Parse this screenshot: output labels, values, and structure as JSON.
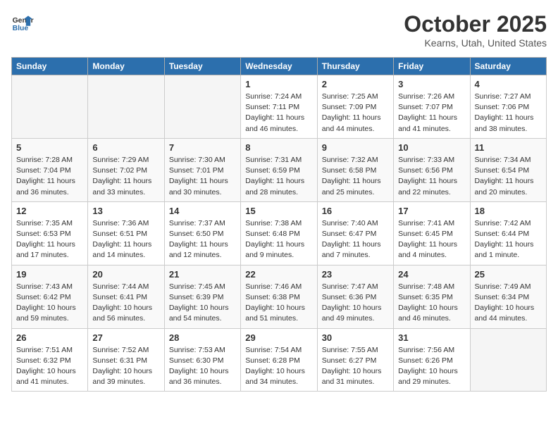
{
  "header": {
    "logo_line1": "General",
    "logo_line2": "Blue",
    "month": "October 2025",
    "location": "Kearns, Utah, United States"
  },
  "days_of_week": [
    "Sunday",
    "Monday",
    "Tuesday",
    "Wednesday",
    "Thursday",
    "Friday",
    "Saturday"
  ],
  "weeks": [
    [
      {
        "day": "",
        "empty": true
      },
      {
        "day": "",
        "empty": true
      },
      {
        "day": "",
        "empty": true
      },
      {
        "day": "1",
        "rise": "7:24 AM",
        "set": "7:11 PM",
        "daylight": "11 hours and 46 minutes."
      },
      {
        "day": "2",
        "rise": "7:25 AM",
        "set": "7:09 PM",
        "daylight": "11 hours and 44 minutes."
      },
      {
        "day": "3",
        "rise": "7:26 AM",
        "set": "7:07 PM",
        "daylight": "11 hours and 41 minutes."
      },
      {
        "day": "4",
        "rise": "7:27 AM",
        "set": "7:06 PM",
        "daylight": "11 hours and 38 minutes."
      }
    ],
    [
      {
        "day": "5",
        "rise": "7:28 AM",
        "set": "7:04 PM",
        "daylight": "11 hours and 36 minutes."
      },
      {
        "day": "6",
        "rise": "7:29 AM",
        "set": "7:02 PM",
        "daylight": "11 hours and 33 minutes."
      },
      {
        "day": "7",
        "rise": "7:30 AM",
        "set": "7:01 PM",
        "daylight": "11 hours and 30 minutes."
      },
      {
        "day": "8",
        "rise": "7:31 AM",
        "set": "6:59 PM",
        "daylight": "11 hours and 28 minutes."
      },
      {
        "day": "9",
        "rise": "7:32 AM",
        "set": "6:58 PM",
        "daylight": "11 hours and 25 minutes."
      },
      {
        "day": "10",
        "rise": "7:33 AM",
        "set": "6:56 PM",
        "daylight": "11 hours and 22 minutes."
      },
      {
        "day": "11",
        "rise": "7:34 AM",
        "set": "6:54 PM",
        "daylight": "11 hours and 20 minutes."
      }
    ],
    [
      {
        "day": "12",
        "rise": "7:35 AM",
        "set": "6:53 PM",
        "daylight": "11 hours and 17 minutes."
      },
      {
        "day": "13",
        "rise": "7:36 AM",
        "set": "6:51 PM",
        "daylight": "11 hours and 14 minutes."
      },
      {
        "day": "14",
        "rise": "7:37 AM",
        "set": "6:50 PM",
        "daylight": "11 hours and 12 minutes."
      },
      {
        "day": "15",
        "rise": "7:38 AM",
        "set": "6:48 PM",
        "daylight": "11 hours and 9 minutes."
      },
      {
        "day": "16",
        "rise": "7:40 AM",
        "set": "6:47 PM",
        "daylight": "11 hours and 7 minutes."
      },
      {
        "day": "17",
        "rise": "7:41 AM",
        "set": "6:45 PM",
        "daylight": "11 hours and 4 minutes."
      },
      {
        "day": "18",
        "rise": "7:42 AM",
        "set": "6:44 PM",
        "daylight": "11 hours and 1 minute."
      }
    ],
    [
      {
        "day": "19",
        "rise": "7:43 AM",
        "set": "6:42 PM",
        "daylight": "10 hours and 59 minutes."
      },
      {
        "day": "20",
        "rise": "7:44 AM",
        "set": "6:41 PM",
        "daylight": "10 hours and 56 minutes."
      },
      {
        "day": "21",
        "rise": "7:45 AM",
        "set": "6:39 PM",
        "daylight": "10 hours and 54 minutes."
      },
      {
        "day": "22",
        "rise": "7:46 AM",
        "set": "6:38 PM",
        "daylight": "10 hours and 51 minutes."
      },
      {
        "day": "23",
        "rise": "7:47 AM",
        "set": "6:36 PM",
        "daylight": "10 hours and 49 minutes."
      },
      {
        "day": "24",
        "rise": "7:48 AM",
        "set": "6:35 PM",
        "daylight": "10 hours and 46 minutes."
      },
      {
        "day": "25",
        "rise": "7:49 AM",
        "set": "6:34 PM",
        "daylight": "10 hours and 44 minutes."
      }
    ],
    [
      {
        "day": "26",
        "rise": "7:51 AM",
        "set": "6:32 PM",
        "daylight": "10 hours and 41 minutes."
      },
      {
        "day": "27",
        "rise": "7:52 AM",
        "set": "6:31 PM",
        "daylight": "10 hours and 39 minutes."
      },
      {
        "day": "28",
        "rise": "7:53 AM",
        "set": "6:30 PM",
        "daylight": "10 hours and 36 minutes."
      },
      {
        "day": "29",
        "rise": "7:54 AM",
        "set": "6:28 PM",
        "daylight": "10 hours and 34 minutes."
      },
      {
        "day": "30",
        "rise": "7:55 AM",
        "set": "6:27 PM",
        "daylight": "10 hours and 31 minutes."
      },
      {
        "day": "31",
        "rise": "7:56 AM",
        "set": "6:26 PM",
        "daylight": "10 hours and 29 minutes."
      },
      {
        "day": "",
        "empty": true
      }
    ]
  ],
  "labels": {
    "sunrise": "Sunrise:",
    "sunset": "Sunset:",
    "daylight": "Daylight:"
  }
}
